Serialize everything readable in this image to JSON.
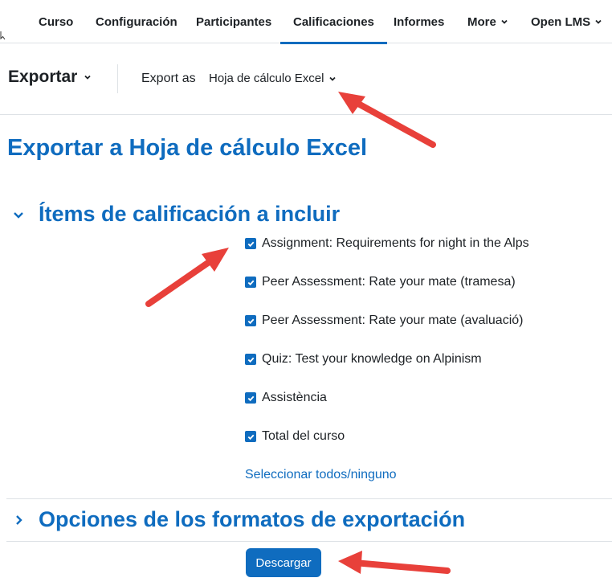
{
  "nav": {
    "items": [
      {
        "label": "Curso"
      },
      {
        "label": "Configuración"
      },
      {
        "label": "Participantes"
      },
      {
        "label": "Calificaciones",
        "active": true
      },
      {
        "label": "Informes"
      },
      {
        "label": "More",
        "dropdown": true
      },
      {
        "label": "Open LMS",
        "dropdown": true
      }
    ]
  },
  "tertiary": {
    "title": "Exportar",
    "export_label": "Export as",
    "export_selected": "Hoja de cálculo Excel"
  },
  "page_title": "Exportar a Hoja de cálculo Excel",
  "grade_items_section": {
    "title": "Ítems de calificación a incluir",
    "expanded": true,
    "items": [
      {
        "label": "Assignment: Requirements for night in the Alps",
        "checked": true
      },
      {
        "label": "Peer Assessment: Rate your mate (tramesa)",
        "checked": true
      },
      {
        "label": "Peer Assessment: Rate your mate (avaluació)",
        "checked": true
      },
      {
        "label": "Quiz: Test your knowledge on Alpinism",
        "checked": true
      },
      {
        "label": "Assistència",
        "checked": true
      },
      {
        "label": "Total del curso",
        "checked": true
      }
    ],
    "select_all_link": "Seleccionar todos/ninguno"
  },
  "format_options_section": {
    "title": "Opciones de los formatos de exportación",
    "expanded": false
  },
  "download_button": "Descargar",
  "colors": {
    "primary": "#0f6cbf",
    "annotation_arrow": "#e8403a",
    "text": "#1d2125",
    "divider": "#dee2e6"
  },
  "icons": {
    "dropdown": "chevron-down-icon",
    "section_expanded": "chevron-down-icon",
    "section_collapsed": "chevron-right-icon",
    "checkbox": "check-icon",
    "annotation": "red-arrow-annotation"
  }
}
